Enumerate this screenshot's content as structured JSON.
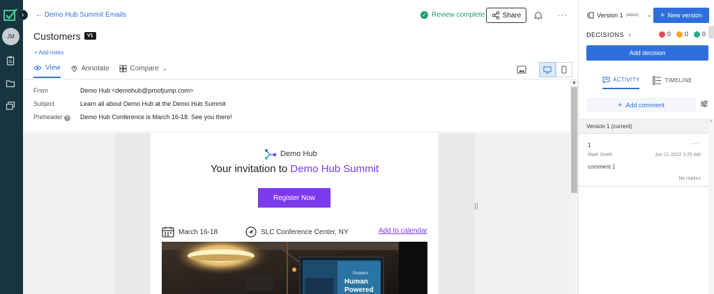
{
  "rail": {
    "avatar_initials": "JM",
    "expand_glyph": "›"
  },
  "header": {
    "back_label": "← Demo Hub Summit Emails",
    "title": "Customers",
    "version_badge": "V1",
    "add_notes": "+ Add notes",
    "review_status": "Review complete",
    "share_label": "Share",
    "more_glyph": "···"
  },
  "tabs": [
    {
      "label": "View",
      "icon": "eye-icon"
    },
    {
      "label": "Annotate",
      "icon": "pin-icon"
    },
    {
      "label": "Compare",
      "icon": "compare-icon"
    }
  ],
  "email_headers": {
    "from_label": "From",
    "from_value": "Demo Hub <demohub@proofjump.com>",
    "subject_label": "Subject",
    "subject_value": "Learn all about Demo Hub at the Demo Hub Summit",
    "preheader_label": "Preheader",
    "preheader_value": "Demo Hub Conference is March 16-18. See you there!",
    "help_glyph": "?"
  },
  "email": {
    "brand_name": "Demo Hub",
    "headline_prefix": "Your invitation to ",
    "headline_highlight": "Demo Hub Summit",
    "cta_label": "Register Now",
    "date_text": "March 16-18",
    "location_text": "SLC Conference Center, NY",
    "calendar_link": "Add to calendar",
    "screen_text_1": "Problem",
    "screen_text_2": "Human",
    "screen_text_3": "Powered"
  },
  "sidebar": {
    "version_label": "Version 1",
    "version_tag": "(latest)",
    "new_version_label": "New version",
    "decisions_label": "DECISIONS",
    "counts": [
      {
        "value": "0",
        "color": "#e5484d"
      },
      {
        "value": "0",
        "color": "#f5a623"
      },
      {
        "value": "0",
        "color": "#20b08c"
      }
    ],
    "add_decision_label": "Add decision",
    "tab_activity": "ACTIVITY",
    "tab_timeline": "TIMELINE",
    "add_comment_label": "Add comment",
    "version_section": "Version 1 (current)",
    "comment": {
      "number": "1",
      "author": "Mark Smith",
      "date": "Jun 21 2022 3:25 AM",
      "text": "comment 1",
      "replies": "No replies"
    }
  },
  "colors": {
    "accent": "#2f6fdd",
    "brand_purple": "#7c3aed",
    "success": "#1e9f6b",
    "rail": "#17343f"
  }
}
